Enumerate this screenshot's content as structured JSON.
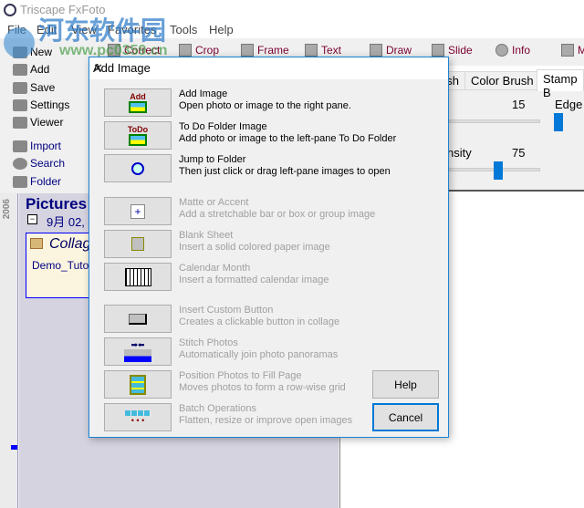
{
  "window": {
    "title": "Triscape FxFoto"
  },
  "menu": [
    "File",
    "Edit",
    "View",
    "Favorites",
    "Tools",
    "Help"
  ],
  "toolbar": [
    "Correct",
    "Crop",
    "Frame",
    "Text",
    "Draw",
    "Slide",
    "Info",
    "M"
  ],
  "sidebar": [
    "New",
    "Add",
    "Save",
    "Settings",
    "Viewer",
    "Import",
    "Search",
    "Folder"
  ],
  "timeline": {
    "year": "2006"
  },
  "left_pane": {
    "title": "Pictures",
    "date": "9月 02,",
    "card_title": "Collag",
    "card_sub": "Demo_Tutor"
  },
  "right_panel": {
    "tabs": [
      "sh",
      "Color Brush",
      "Stamp B"
    ],
    "value1": "15",
    "edge_label": "Edge",
    "density_label": "nsity",
    "value2": "75",
    "accent": "#0078d7"
  },
  "dialog": {
    "title": "Add Image",
    "rows": [
      {
        "icon": "add-photo-icon",
        "label": "Add",
        "title": "Add Image",
        "desc": "Open photo or image to the right pane.",
        "enabled": true
      },
      {
        "icon": "todo-photo-icon",
        "label": "ToDo",
        "title": "To Do Folder Image",
        "desc": "Add photo or image to the left-pane To Do Folder",
        "enabled": true
      },
      {
        "icon": "magnifier-icon",
        "title": "Jump to Folder",
        "desc": "Then just click or drag left-pane images to open",
        "enabled": true
      },
      {
        "icon": "matte-icon",
        "title": "Matte or Accent",
        "desc": "Add a stretchable bar or box or group image",
        "enabled": false
      },
      {
        "icon": "blank-sheet-icon",
        "title": "Blank Sheet",
        "desc": "Insert a solid colored paper image",
        "enabled": false
      },
      {
        "icon": "calendar-icon",
        "title": "Calendar Month",
        "desc": "Insert a formatted calendar image",
        "enabled": false
      },
      {
        "icon": "custom-button-icon",
        "title": "Insert Custom Button",
        "desc": "Creates a clickable button in collage",
        "enabled": false
      },
      {
        "icon": "stitch-icon",
        "title": "Stitch Photos",
        "desc": "Automatically join photo panoramas",
        "enabled": false
      },
      {
        "icon": "grid-icon",
        "title": "Position Photos to Fill Page",
        "desc": "Moves photos to form a row-wise grid",
        "enabled": false
      },
      {
        "icon": "batch-icon",
        "title": "Batch Operations",
        "desc": "Flatten, resize or improve open images",
        "enabled": false
      }
    ],
    "help": "Help",
    "cancel": "Cancel"
  },
  "watermark": {
    "text": "河东软件园",
    "url": "www.pc0359.cn"
  }
}
